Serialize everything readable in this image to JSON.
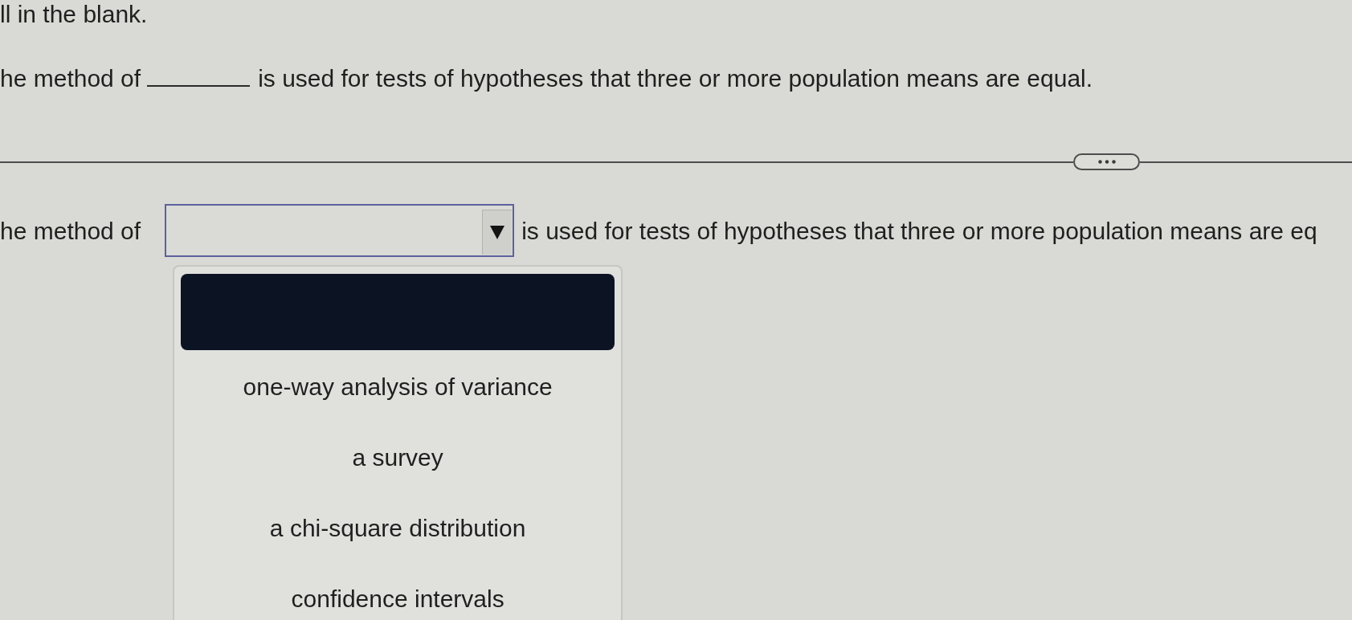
{
  "instruction": {
    "text": "ll in the blank."
  },
  "question": {
    "text_before": "he method of",
    "text_after": "is used for tests of hypotheses that three or more population means are equal."
  },
  "answer": {
    "text_before": "he method of",
    "dropdown": {
      "expanded": true,
      "blank_option": {
        "highlighted": true
      },
      "options": [
        {
          "label": "one-way analysis of variance",
          "selected": false
        },
        {
          "label": "a survey",
          "selected": false
        },
        {
          "label": "a chi-square distribution",
          "selected": false
        },
        {
          "label": "confidence intervals",
          "selected": false
        }
      ]
    },
    "text_after": "is used for tests of hypotheses that three or more population means are eq"
  }
}
